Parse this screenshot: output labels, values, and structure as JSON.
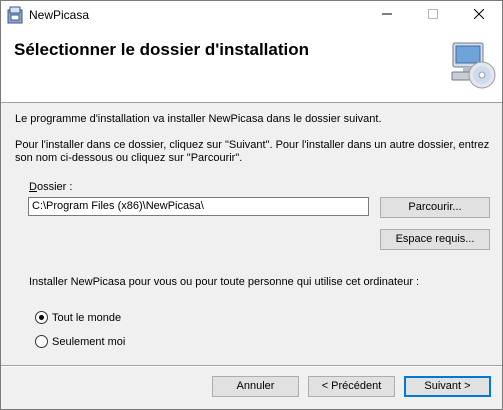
{
  "window": {
    "title": "NewPicasa",
    "icons": {
      "app": "installer-package-icon",
      "minimize": "minimize-icon",
      "maximize": "maximize-icon",
      "close": "close-icon"
    }
  },
  "header": {
    "title": "Sélectionner le dossier d'installation",
    "icon": "computer-cd-icon"
  },
  "body": {
    "intro": "Le programme d'installation va installer NewPicasa dans le dossier suivant.",
    "instructions_line1": "Pour l'installer dans ce dossier, cliquez sur \"Suivant\". Pour l'installer dans un autre dossier, entrez",
    "instructions_line2": "son nom ci-dessous ou cliquez sur \"Parcourir\"."
  },
  "folder": {
    "label_underlined": "D",
    "label_rest": "ossier :",
    "value": "C:\\Program Files (x86)\\NewPicasa\\",
    "browse_label": "Parcourir...",
    "disk_space_label": "Espace requis..."
  },
  "scope": {
    "question": "Installer NewPicasa pour vous ou pour toute personne qui utilise cet ordinateur :",
    "options": [
      {
        "label": "Tout le monde",
        "checked": true
      },
      {
        "label": "Seulement moi",
        "checked": false
      }
    ]
  },
  "footer": {
    "cancel_label": "Annuler",
    "previous_label": "< Précédent",
    "next_label": "Suivant >"
  },
  "colors": {
    "accent": "#0078d7",
    "button_bg": "#e1e1e1",
    "dialog_bg": "#f0f0f0"
  }
}
